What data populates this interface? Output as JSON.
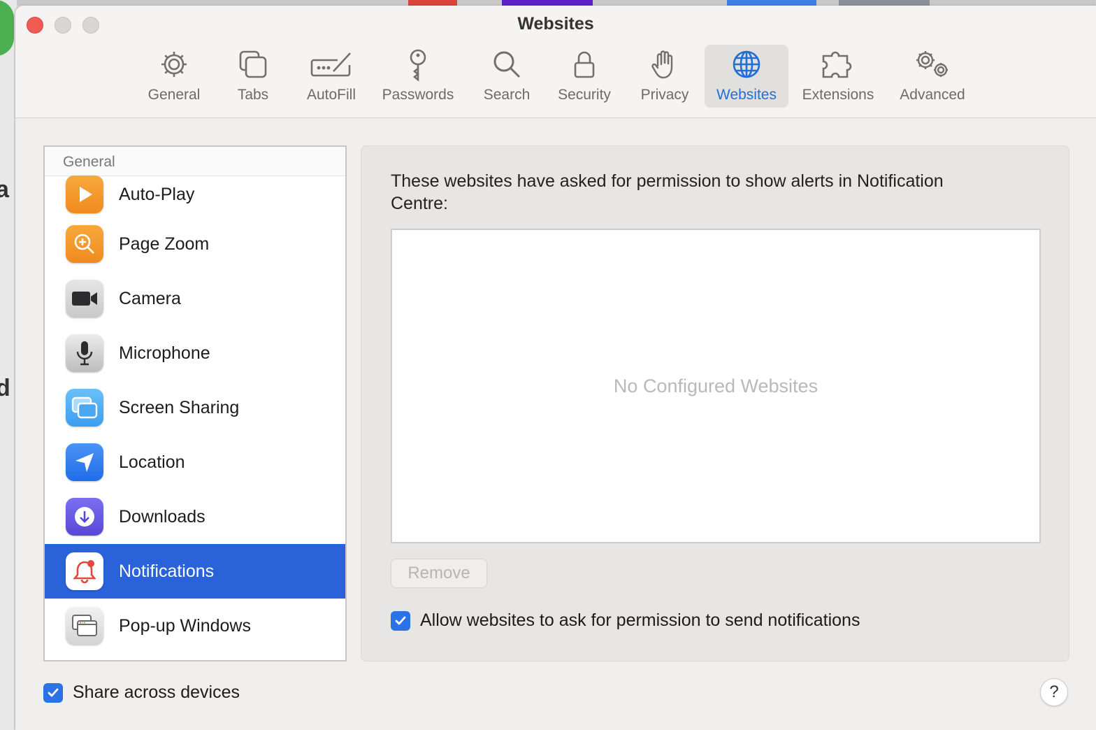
{
  "window": {
    "title": "Websites"
  },
  "toolbar": {
    "tabs": [
      {
        "label": "General",
        "icon": "gear-icon"
      },
      {
        "label": "Tabs",
        "icon": "tabs-icon"
      },
      {
        "label": "AutoFill",
        "icon": "autofill-pencil-icon"
      },
      {
        "label": "Passwords",
        "icon": "key-icon"
      },
      {
        "label": "Search",
        "icon": "magnifier-icon"
      },
      {
        "label": "Security",
        "icon": "lock-icon"
      },
      {
        "label": "Privacy",
        "icon": "hand-icon"
      },
      {
        "label": "Websites",
        "icon": "globe-icon",
        "active": true
      },
      {
        "label": "Extensions",
        "icon": "puzzle-icon"
      },
      {
        "label": "Advanced",
        "icon": "gears-icon"
      }
    ]
  },
  "sidebar": {
    "header": "General",
    "items": [
      {
        "label": "Auto-Play",
        "icon": "play-icon",
        "color": "#f59b2b"
      },
      {
        "label": "Page Zoom",
        "icon": "zoom-icon",
        "color": "#f59b2b"
      },
      {
        "label": "Camera",
        "icon": "camera-icon",
        "color": "#3a3a3c"
      },
      {
        "label": "Microphone",
        "icon": "microphone-icon",
        "color": "#d8d8d8"
      },
      {
        "label": "Screen Sharing",
        "icon": "screen-sharing-icon",
        "color": "#4aa8f0"
      },
      {
        "label": "Location",
        "icon": "location-arrow-icon",
        "color": "#2f7ef0"
      },
      {
        "label": "Downloads",
        "icon": "download-icon",
        "color": "#6a5ee0"
      },
      {
        "label": "Notifications",
        "icon": "bell-icon",
        "color": "#ffffff",
        "selected": true
      },
      {
        "label": "Pop-up Windows",
        "icon": "popup-window-icon",
        "color": "#e8e8e8"
      }
    ]
  },
  "panel": {
    "prompt": "These websites have asked for permission to show alerts in Notification Centre:",
    "empty_text": "No Configured Websites",
    "remove_label": "Remove",
    "allow_label": "Allow websites to ask for permission to send notifications",
    "allow_checked": true
  },
  "footer": {
    "share_label": "Share across devices",
    "share_checked": true,
    "help_label": "?"
  },
  "colors": {
    "accent": "#2a62d9",
    "active_tab": "#1f6fd6",
    "checkbox": "#2b72e6"
  }
}
